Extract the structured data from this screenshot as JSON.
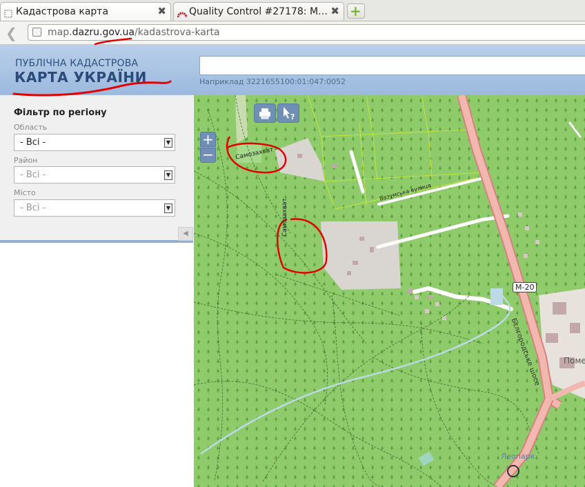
{
  "browser": {
    "tabs": [
      {
        "title": "Кадастрова карта",
        "active": true
      },
      {
        "title": "Quality Control #27178: M…",
        "active": false
      }
    ],
    "new_tab_symbol": "+",
    "close_symbol": "✖",
    "back_symbol": "❮",
    "url": {
      "prefix": "map.",
      "domain": "dazru.gov.ua",
      "path": "/kadastrova-karta"
    }
  },
  "site": {
    "logo_line1": "ПУБЛІЧНА КАДАСТРОВА",
    "logo_line2": "КАРТА УКРАЇНИ",
    "search": {
      "value": "",
      "hint": "Наприклад 3221655100:01:047:0052"
    }
  },
  "sidebar": {
    "title": "Фільтр по регіону",
    "fields": [
      {
        "label": "Область",
        "value": "- Всі -",
        "disabled": false
      },
      {
        "label": "Район",
        "value": "- Всі -",
        "disabled": true
      },
      {
        "label": "Місто",
        "value": "- Всі -",
        "disabled": true
      }
    ],
    "dropdown_arrow": "▼",
    "collapse_symbol": "◀"
  },
  "map": {
    "zoom_in": "+",
    "zoom_out": "−",
    "labels": {
      "samozakhvat_1": "Самозахват",
      "samozakhvat_2": "Самозахват",
      "bazumska": "Базумська вулиця",
      "m20": "M-20",
      "bilhorod": "Бєлгородське шосе",
      "pome": "Поме",
      "leopark": "Леопарк"
    }
  },
  "colors": {
    "forest": "#8fca6b",
    "highway": "#e8a0a0",
    "annotation": "#e00000",
    "header": "#a8c3e3"
  }
}
